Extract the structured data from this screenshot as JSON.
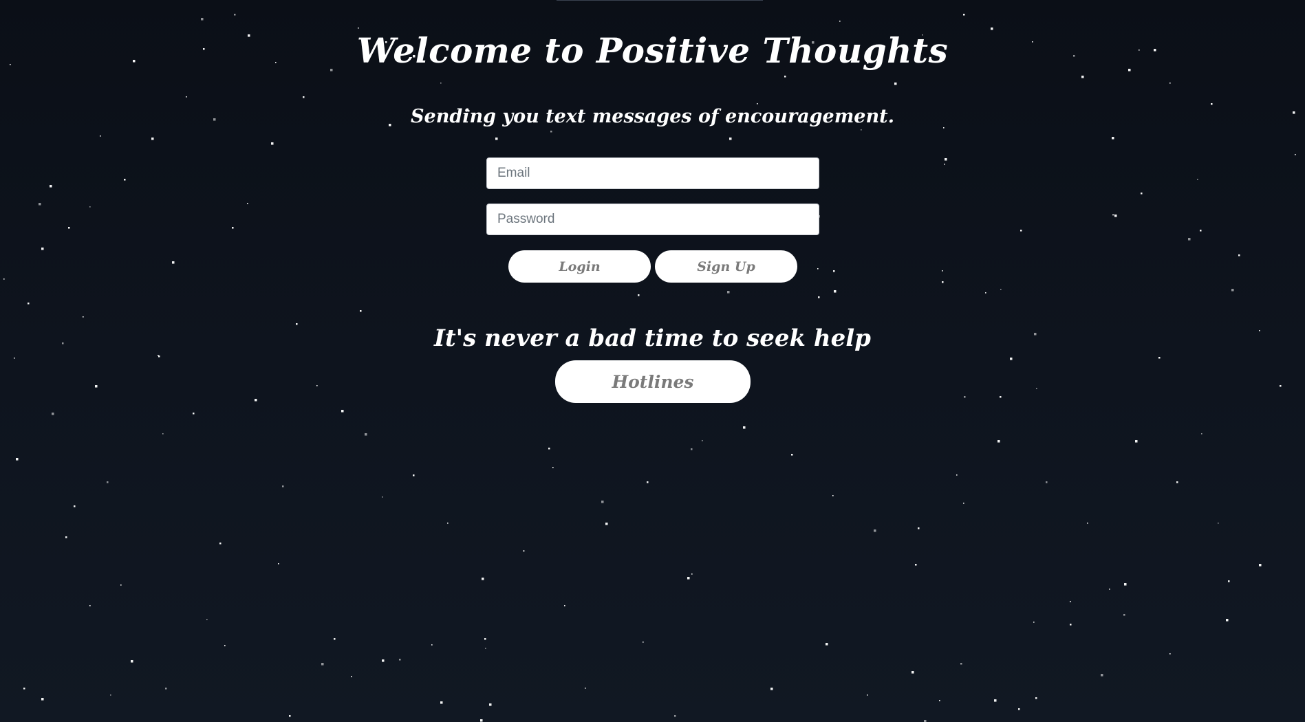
{
  "header": {
    "title": "Welcome to Positive Thoughts",
    "subtitle": "Sending you text messages of encouragement."
  },
  "form": {
    "email_placeholder": "Email",
    "password_placeholder": "Password",
    "login_label": "Login",
    "signup_label": "Sign Up"
  },
  "help": {
    "text": "It's never a bad time to seek help",
    "hotlines_label": "Hotlines"
  },
  "colors": {
    "background": "#0e141e",
    "text": "#ffffff",
    "button_background": "#ffffff",
    "button_text": "#7a7a7a"
  }
}
